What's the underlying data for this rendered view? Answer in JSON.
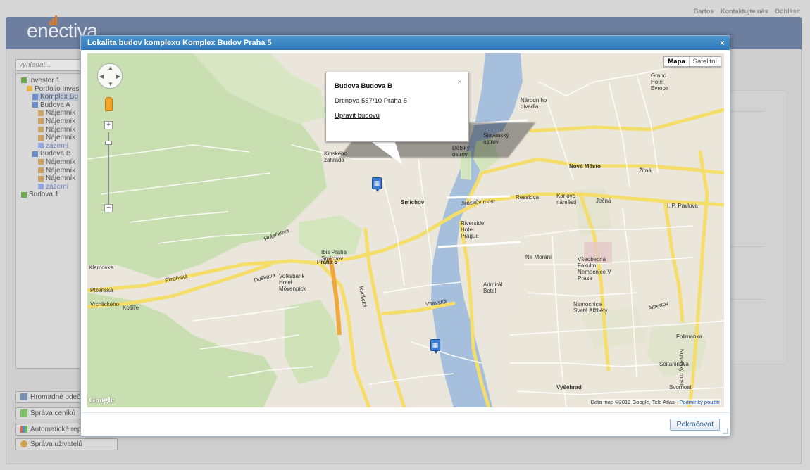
{
  "header": {
    "links": [
      "Bartos",
      "Kontaktujte nás",
      "Odhlásit"
    ],
    "logo_text": "enectiva"
  },
  "sidebar": {
    "search_placeholder": "vyhledat...",
    "tree": [
      {
        "label": "Investor 1",
        "level": 0
      },
      {
        "label": "Portfolio Inves",
        "level": 1
      },
      {
        "label": "Komplex Bu",
        "level": 2,
        "selected": true
      },
      {
        "label": "Budova A",
        "level": 2
      },
      {
        "label": "Nájemník",
        "level": 3
      },
      {
        "label": "Nájemník",
        "level": 3
      },
      {
        "label": "Nájemník",
        "level": 3
      },
      {
        "label": "Nájemník",
        "level": 3
      },
      {
        "label": "zázemí",
        "level": 3,
        "link": true
      },
      {
        "label": "Budova B",
        "level": 2
      },
      {
        "label": "Nájemník",
        "level": 3
      },
      {
        "label": "Nájemník",
        "level": 3
      },
      {
        "label": "Nájemník",
        "level": 3
      },
      {
        "label": "zázemí",
        "level": 3,
        "link": true
      },
      {
        "label": "Budova 1",
        "level": 0
      }
    ],
    "buttons": [
      {
        "label": "Hromadné odečty",
        "icon": "meter-icon"
      },
      {
        "label": "Správa ceníků",
        "icon": "price-tag-icon"
      },
      {
        "label": "Automatické repor",
        "icon": "report-chart-icon"
      },
      {
        "label": "Správa uživatelů",
        "icon": "users-icon"
      }
    ]
  },
  "modal": {
    "title": "Lokalita budov komplexu Komplex Budov Praha 5",
    "close_symbol": "×",
    "continue_label": "Pokračovat"
  },
  "map": {
    "map_type_buttons": [
      "Mapa",
      "Satelitní"
    ],
    "zoom_in": "+",
    "zoom_out": "−",
    "info_window": {
      "title": "Budova Budova B",
      "address": "Drtinova 557/10 Praha 5",
      "link": "Upravit budovu",
      "close": "×"
    },
    "footer_text": "Data map ©2012 Google, Tele Atlas -",
    "footer_link": "Podmínky použití",
    "logo": "Google",
    "labels": {
      "smichov": "Smíchov",
      "praha5": "Praha 5",
      "nove_mesto": "Nové Město",
      "kinskeho": "Kinského zahrada",
      "jiraskuv": "Jiráskův most",
      "plzenska": "Plzeňská",
      "resslova": "Resslova",
      "zitna": "Žitná",
      "jecna": "Ječná",
      "vysehrad": "Vyšehrad",
      "folimanka": "Folimanka",
      "kosire": "Košíře",
      "klamovka": "Klamovka",
      "nemocnice_alzbety": "Nemocnice Svaté Alžběty",
      "vseobecna": "Všeobecná Fakultní Nemocnice V Praze",
      "grand_hotel": "Grand Hotel Evropa",
      "narodni_divadlo": "Národního divadla",
      "riverside": "Riverside Hotel Prague",
      "admiral": "Admirál Botel",
      "ibis": "Ibis Praha Smíchov",
      "volksbank": "Volksbank Hotel Mövenpick",
      "slovansky": "Slovanský ostrov",
      "detsky": "Dětský ostrov",
      "karlovo": "Karlovo náměstí",
      "ip_pavlova": "I. P. Pavlova",
      "nuselsky": "Nuselský most",
      "holeckova": "Holečkova",
      "vltavska": "Vltavská",
      "radlicka": "Radlická",
      "duskova": "Duškova",
      "na_morani": "Na Moráni",
      "svornosti": "Svornosti",
      "sekaninova": "Sekaninova",
      "albertov": "Albertov",
      "hradcanska": "Vrchlického"
    }
  },
  "colors": {
    "title_bar": "#3584c4",
    "river": "#a5bfdd",
    "park": "#c8dfb0",
    "major_road": "#f7e47e",
    "marker": "#3a7bd5"
  }
}
